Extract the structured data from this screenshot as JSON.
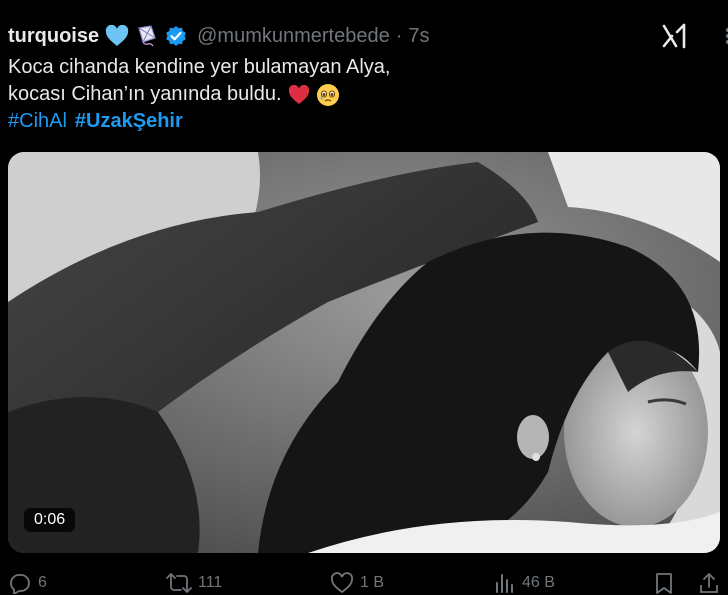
{
  "tweet": {
    "display_name": "turquoise",
    "handle": "@mumkunmertebede",
    "separator": "·",
    "time": "7s",
    "text_line1": "Koca cihanda kendine yer bulamayan Alya,",
    "text_line2": "kocası Cihan’ın yanında buldu.",
    "hashtags": [
      "#CihAl",
      "#UzakŞehir"
    ]
  },
  "media": {
    "duration": "0:06"
  },
  "actions": {
    "replies": "6",
    "reposts": "111",
    "likes": "1 B",
    "views": "46 B"
  },
  "icons": {
    "header_emojis": [
      "blue-heart-icon",
      "kite-icon",
      "verified-badge-icon"
    ],
    "line2_emojis": [
      "red-heart-icon",
      "teary-face-icon"
    ],
    "grok": "grok-icon",
    "actions": [
      "reply-icon",
      "repost-icon",
      "like-icon",
      "views-icon",
      "bookmark-icon",
      "share-icon"
    ]
  },
  "colors": {
    "background": "#000000",
    "text": "#e7e9ea",
    "muted": "#71767b",
    "link": "#1d9bf0",
    "verified": "#1d9bf0"
  }
}
